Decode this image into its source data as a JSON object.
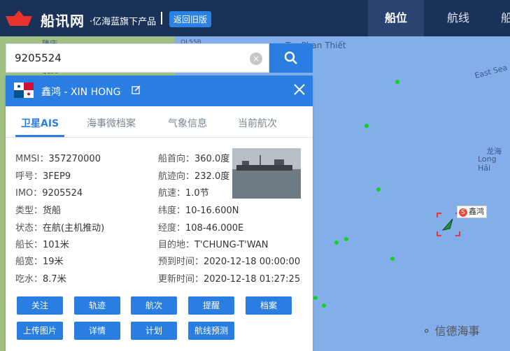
{
  "header": {
    "logo_text": "船讯网",
    "logo_sub": "·亿海蓝旗下产品",
    "old_version_button": "返回旧版",
    "nav": [
      "船位",
      "航线",
      "船"
    ]
  },
  "map": {
    "labels": [
      "隆庆",
      "QL55B",
      "QL58",
      "Tp. Phan Thiết",
      "East Sea",
      "龙海",
      "Long Hải",
      "海"
    ]
  },
  "search": {
    "value": "9205524",
    "clear_icon": "×"
  },
  "ship": {
    "name": "鑫鸿 -  XIN HONG",
    "flag": "Panama",
    "marker_label": "鑫鸿",
    "marker_badge": "S"
  },
  "tabs": [
    "卫星AIS",
    "海事微档案",
    "气象信息",
    "当前航次"
  ],
  "info_left": [
    {
      "label": "MMSI：",
      "value": "357270000"
    },
    {
      "label": "呼号：",
      "value": "3FEP9"
    },
    {
      "label": "IMO：",
      "value": "9205524"
    },
    {
      "label": "类型：",
      "value": "货船"
    },
    {
      "label": "状态：",
      "value": "在航(主机推动)"
    },
    {
      "label": "船长：",
      "value": "101米"
    },
    {
      "label": "船宽：",
      "value": "19米"
    },
    {
      "label": "吃水：",
      "value": "8.7米"
    }
  ],
  "info_right": [
    {
      "label": "船首向：",
      "value": "360.0度"
    },
    {
      "label": "航迹向：",
      "value": "232.0度"
    },
    {
      "label": "航速：",
      "value": "1.0节"
    },
    {
      "label": "纬度：",
      "value": "10-16.600N"
    },
    {
      "label": "经度：",
      "value": "108-46.000E"
    },
    {
      "label": "目的地：",
      "value": "T'CHUNG-T'WAN"
    },
    {
      "label": "预到时间：",
      "value": "2020-12-18 00:00:00"
    },
    {
      "label": "更新时间：",
      "value": "2020-12-18 01:27:25"
    }
  ],
  "buttons_row1": [
    "关注",
    "轨迹",
    "航次",
    "提醒",
    "档案"
  ],
  "buttons_row2": [
    "上传图片",
    "详情",
    "计划",
    "航线预测"
  ],
  "watermark": "信德海事",
  "colors": {
    "accent": "#2a7de1",
    "header_bg": "#1b3258",
    "sea": "#84aeea",
    "ais_dot": "#12d21c"
  }
}
